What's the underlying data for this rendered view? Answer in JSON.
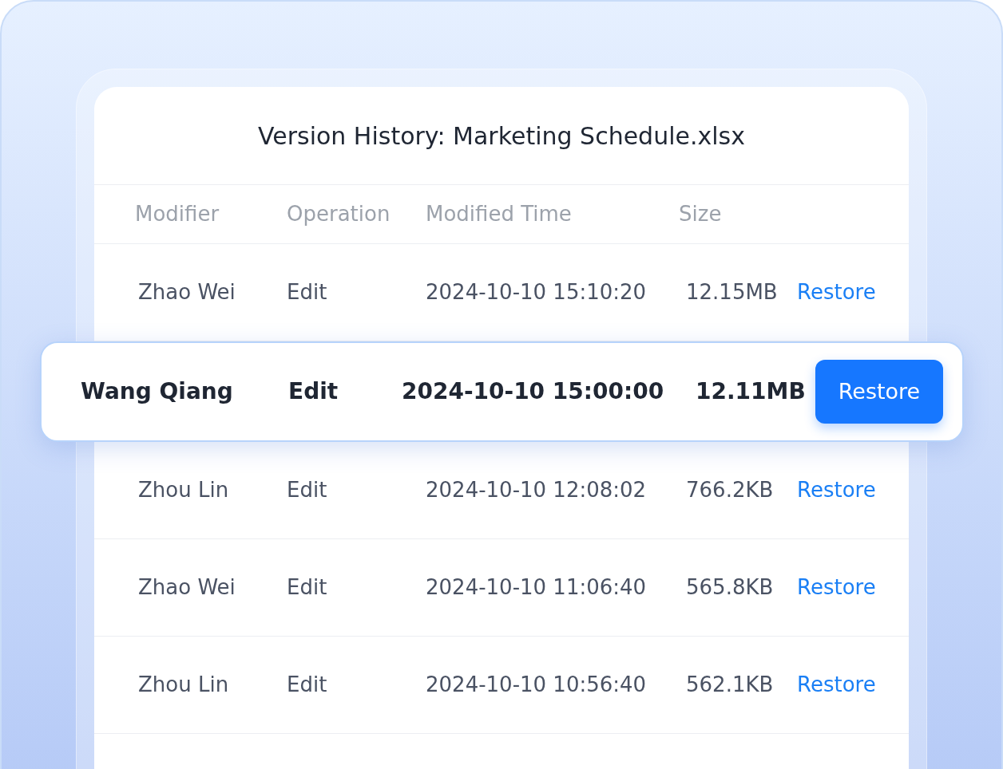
{
  "title": "Version History: Marketing Schedule.xlsx",
  "columns": [
    "Modifier",
    "Operation",
    "Modified Time",
    "Size"
  ],
  "rows": [
    {
      "modifier": "Zhao Wei",
      "operation": "Edit",
      "time": "2024-10-10 15:10:20",
      "size": "12.15MB",
      "action": "Restore",
      "highlighted": false
    },
    {
      "modifier": "Wang Qiang",
      "operation": "Edit",
      "time": "2024-10-10 15:00:00",
      "size": "12.11MB",
      "action": "Restore",
      "highlighted": true
    },
    {
      "modifier": "Zhou Lin",
      "operation": "Edit",
      "time": "2024-10-10 12:08:02",
      "size": "766.2KB",
      "action": "Restore",
      "highlighted": false
    },
    {
      "modifier": "Zhao Wei",
      "operation": "Edit",
      "time": "2024-10-10 11:06:40",
      "size": "565.8KB",
      "action": "Restore",
      "highlighted": false
    },
    {
      "modifier": "Zhou Lin",
      "operation": "Edit",
      "time": "2024-10-10 10:56:40",
      "size": "562.1KB",
      "action": "Restore",
      "highlighted": false
    }
  ]
}
